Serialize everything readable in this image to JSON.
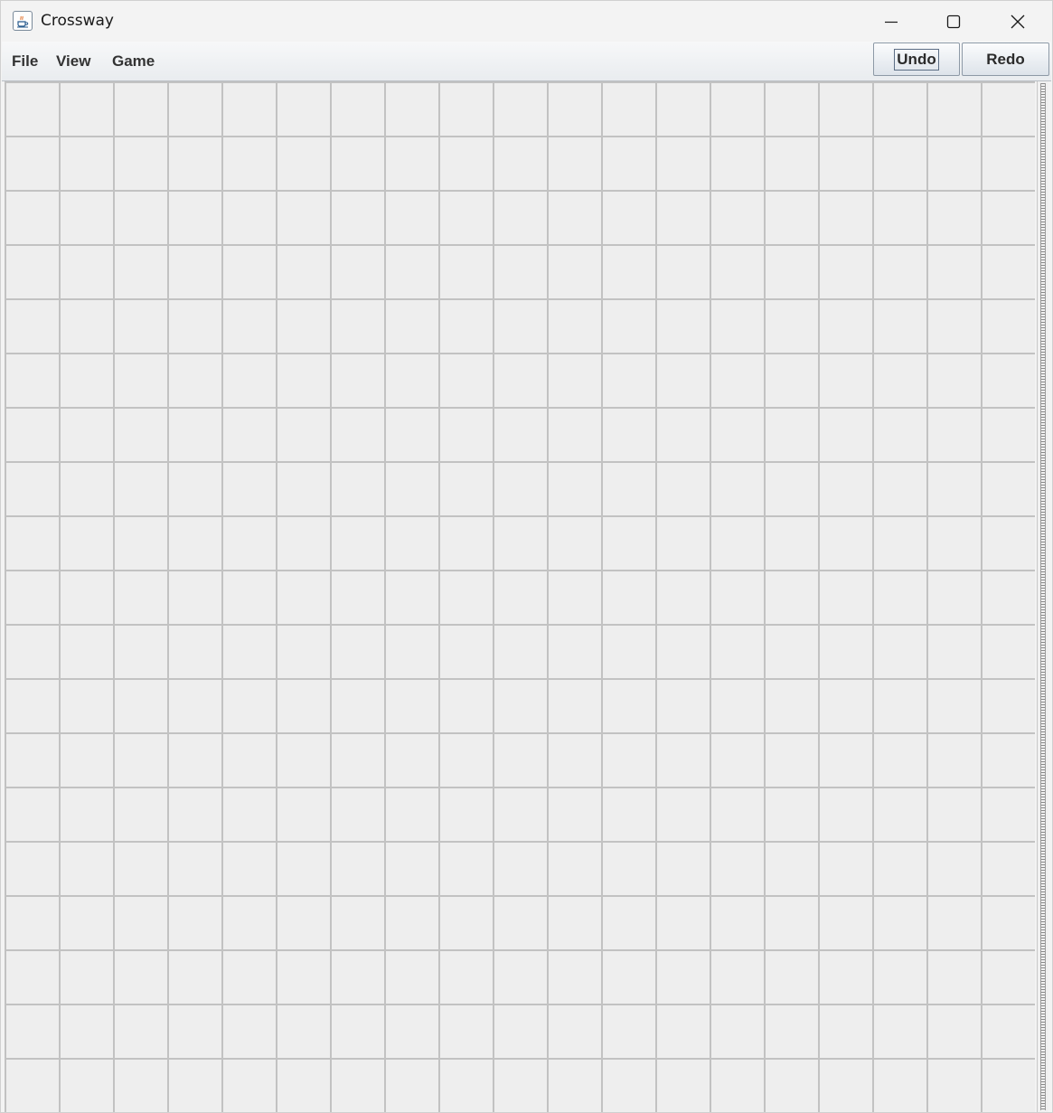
{
  "window": {
    "title": "Crossway",
    "icon": "java-cup-icon",
    "controls": [
      "minimize-icon",
      "maximize-icon",
      "close-icon"
    ]
  },
  "menubar": {
    "items": [
      {
        "label": "File"
      },
      {
        "label": "View"
      },
      {
        "label": "Game"
      }
    ]
  },
  "toolbar": {
    "undo_label": "Undo",
    "redo_label": "Redo"
  },
  "board": {
    "rows": 19,
    "cols": 19,
    "cell_color": "#eeeeee",
    "line_color": "#c2c2c2"
  }
}
